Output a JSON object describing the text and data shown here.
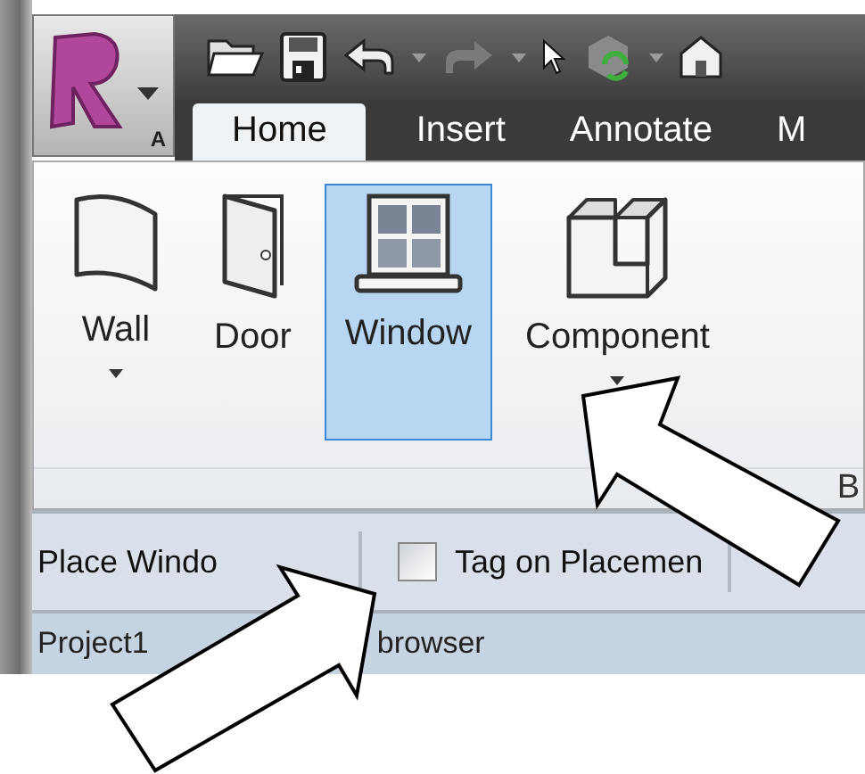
{
  "app_button": {
    "badge": "A"
  },
  "tabs": [
    {
      "label": "Home",
      "selected": true
    },
    {
      "label": "Insert",
      "selected": false
    },
    {
      "label": "Annotate",
      "selected": false
    },
    {
      "label": "M",
      "selected": false
    }
  ],
  "tools": [
    {
      "kind": "wall",
      "label": "Wall",
      "dropdown": true,
      "selected": false
    },
    {
      "kind": "door",
      "label": "Door",
      "dropdown": false,
      "selected": false
    },
    {
      "kind": "window",
      "label": "Window",
      "dropdown": false,
      "selected": true
    },
    {
      "kind": "component",
      "label": "Component",
      "dropdown": true,
      "selected": false
    }
  ],
  "panel_label": "B",
  "options_bar": {
    "label": "Place Windo",
    "tag_on_placement": {
      "label": "Tag on Placemen",
      "checked": false
    }
  },
  "browser": {
    "title_parts": [
      "Project1",
      "browser"
    ]
  }
}
